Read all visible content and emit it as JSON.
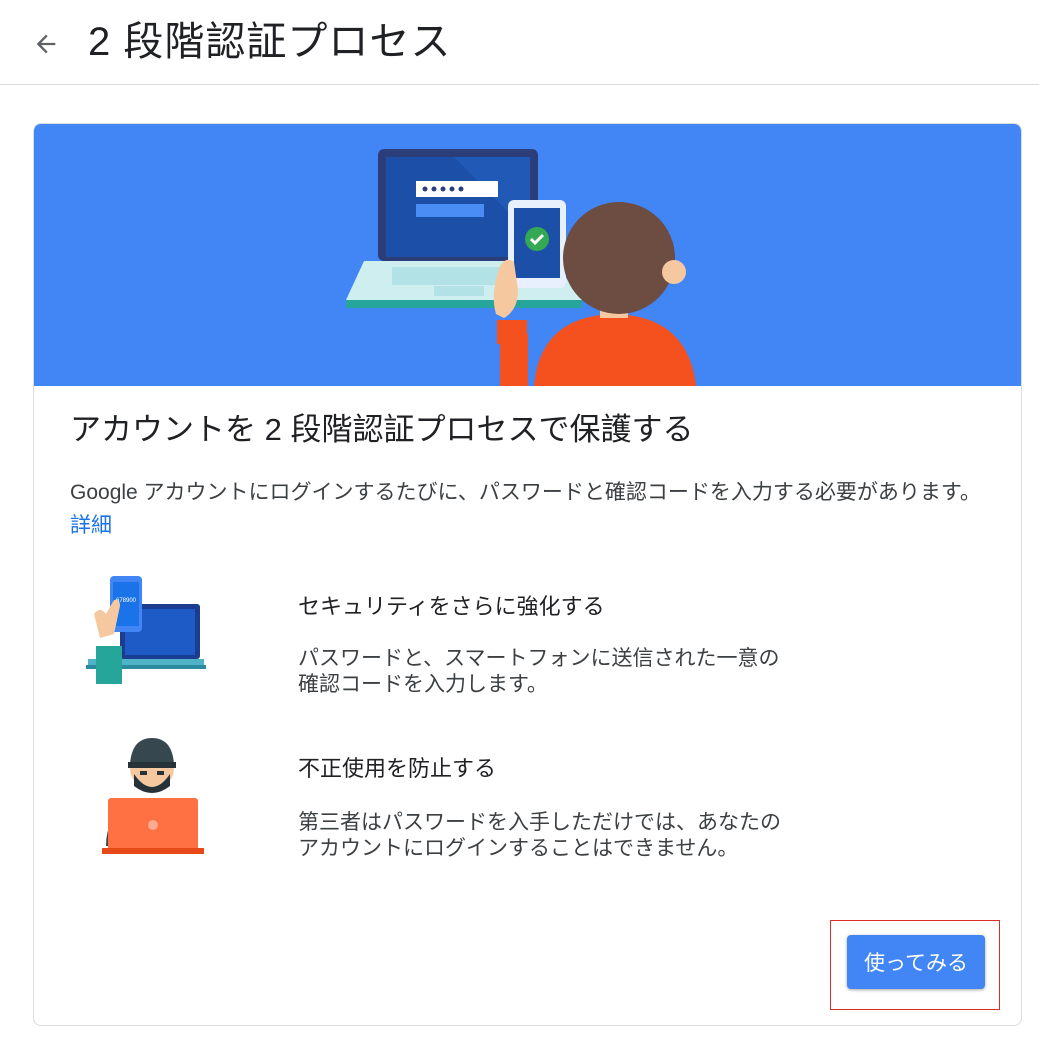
{
  "header": {
    "title": "2 段階認証プロセス",
    "back_icon": "arrow-back-icon"
  },
  "card": {
    "title": "アカウントを 2 段階認証プロセスで保護する",
    "intro_text": "Google アカウントにログインするたびに、パスワードと確認コードを入力する必要があります。",
    "learn_more": "詳細",
    "features": [
      {
        "icon": "phone-code-laptop-icon",
        "title": "セキュリティをさらに強化する",
        "description_line1": "パスワードと、スマートフォンに送信された一意の",
        "description_line2": "確認コードを入力します。"
      },
      {
        "icon": "hacker-laptop-icon",
        "title": "不正使用を防止する",
        "description_line1": "第三者はパスワードを入手しただけでは、あなたの",
        "description_line2": "アカウントにログインすることはできません。"
      }
    ],
    "cta_label": "使ってみる",
    "phone_code_digits": "678900"
  },
  "colors": {
    "hero_bg": "#4285f4",
    "primary": "#4285f4",
    "link": "#1a73e8",
    "focus_outline": "#d93025"
  }
}
